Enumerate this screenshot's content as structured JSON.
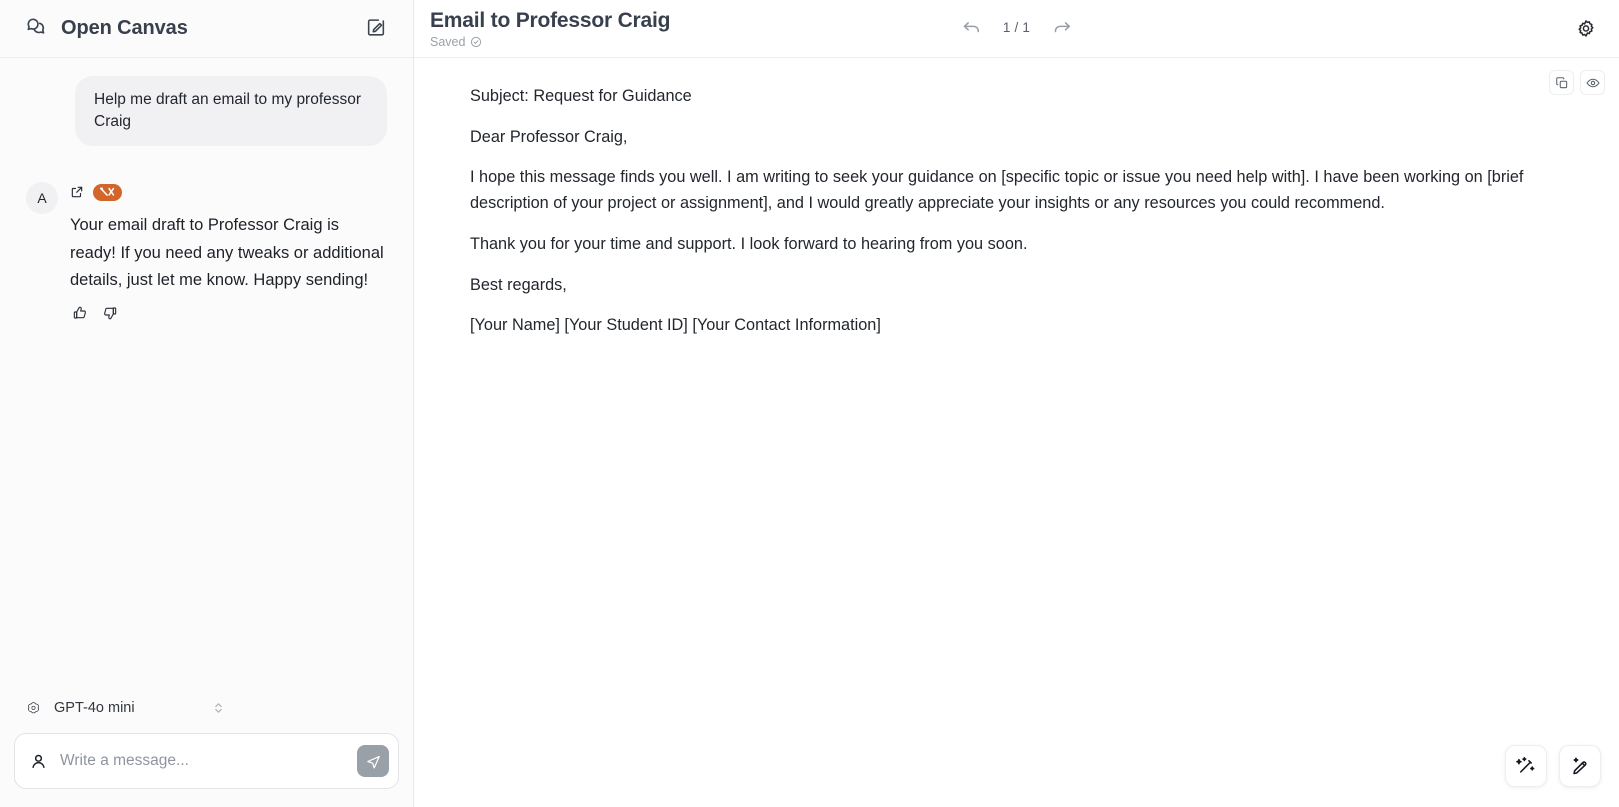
{
  "sidebar": {
    "brand": {
      "title": "Open Canvas",
      "logo_icon": "chat-bubbles-icon"
    },
    "new_chat_icon": "compose-square-pen-icon",
    "messages": [
      {
        "role": "user",
        "text": "Help me draft an email to my professor Craig"
      },
      {
        "role": "assistant",
        "avatar_initial": "A",
        "badges": [
          {
            "icon": "external-link-icon",
            "name": "open-in-new-icon"
          },
          {
            "icon": "langsmith-tools-icon",
            "name": "trace-badge",
            "color": "#d2652a"
          }
        ],
        "text": "Your email draft to Professor Craig is ready! If you need any tweaks or additional details, just let me know. Happy sending!",
        "feedback": {
          "thumbs_up_icon": "thumbs-up-icon",
          "thumbs_down_icon": "thumbs-down-icon"
        }
      }
    ],
    "model_selector": {
      "icon": "openai-logo-icon",
      "label": "GPT-4o mini",
      "chevron_icon": "chevron-up-down-icon"
    },
    "composer": {
      "user_icon": "person-icon",
      "value": "",
      "placeholder": "Write a message...",
      "send_icon": "send-paper-plane-icon"
    }
  },
  "canvas": {
    "header": {
      "title": "Email to Professor Craig",
      "saved_label": "Saved",
      "saved_icon": "check-circle-icon",
      "prev_icon": "arrow-undo-left-icon",
      "next_icon": "arrow-redo-right-icon",
      "page_indicator": "1 / 1",
      "settings_icon": "gear-icon"
    },
    "toolbar": [
      {
        "name": "copy-button",
        "icon": "copy-icon"
      },
      {
        "name": "preview-button",
        "icon": "eye-icon"
      }
    ],
    "document": {
      "paragraphs": [
        "Subject: Request for Guidance",
        "Dear Professor Craig,",
        "I hope this message finds you well. I am writing to seek your guidance on [specific topic or issue you need help with]. I have been working on [brief description of your project or assignment], and I would greatly appreciate your insights or any resources you could recommend.",
        "Thank you for your time and support. I look forward to hearing from you soon.",
        "Best regards,",
        "[Your Name] [Your Student ID] [Your Contact Information]"
      ]
    },
    "fabs": [
      {
        "name": "magic-wand-button",
        "icon": "magic-wand-sparkles-icon"
      },
      {
        "name": "edit-pen-button",
        "icon": "pen-sparkle-icon"
      }
    ]
  },
  "colors": {
    "accent_orange": "#d2652a",
    "sidebar_bg": "#fbfbfb",
    "bubble_bg": "#f1f1f3",
    "text_primary": "#22262d",
    "text_muted": "#9ba0a8"
  }
}
